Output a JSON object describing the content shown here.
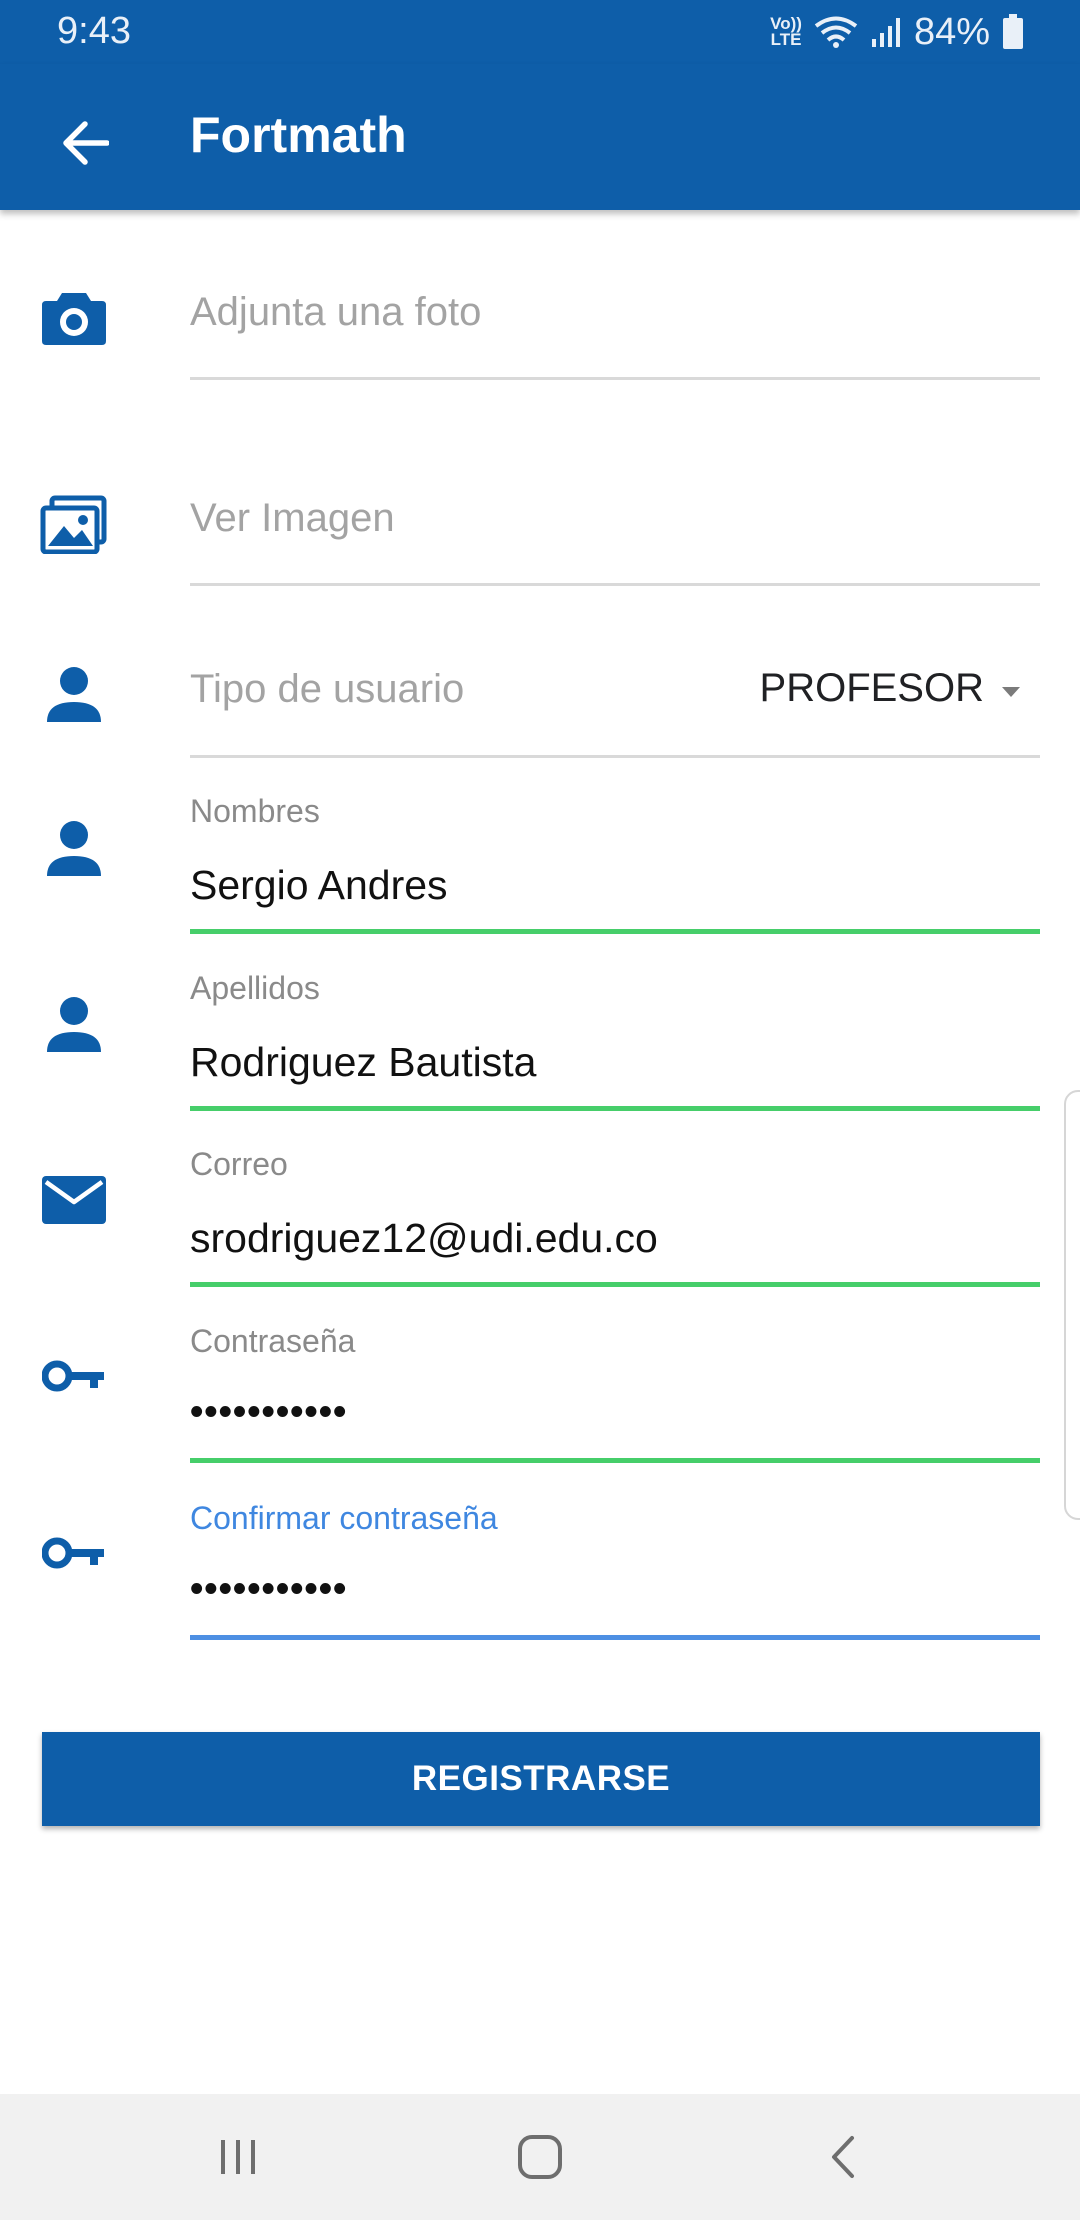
{
  "status_bar": {
    "time": "9:43",
    "volte_top": "Vo))",
    "volte_bottom": "LTE",
    "battery_percent": "84%"
  },
  "app_bar": {
    "title": "Fortmath",
    "back_icon": "arrow-left-icon"
  },
  "form": {
    "photo": {
      "placeholder": "Adjunta una foto",
      "icon": "camera-icon"
    },
    "image": {
      "placeholder": "Ver Imagen",
      "icon": "images-icon"
    },
    "user_type": {
      "label": "Tipo de usuario",
      "selected": "PROFESOR",
      "icon": "person-icon"
    },
    "first_name": {
      "label": "Nombres",
      "value": "Sergio Andres",
      "icon": "person-icon"
    },
    "last_name": {
      "label": "Apellidos",
      "value": "Rodriguez Bautista",
      "icon": "person-icon"
    },
    "email": {
      "label": "Correo",
      "value": "srodriguez12@udi.edu.co",
      "icon": "mail-icon"
    },
    "password": {
      "label": "Contraseña",
      "value": "•••••••••••",
      "icon": "key-icon"
    },
    "confirm_password": {
      "label": "Confirmar contraseña",
      "value": "•••••••••••",
      "icon": "key-icon"
    }
  },
  "register_button": {
    "label": "REGISTRARSE"
  },
  "colors": {
    "primary": "#0e5ea9",
    "valid_underline": "#46ce6a",
    "focus_underline": "#4d8fe3"
  }
}
